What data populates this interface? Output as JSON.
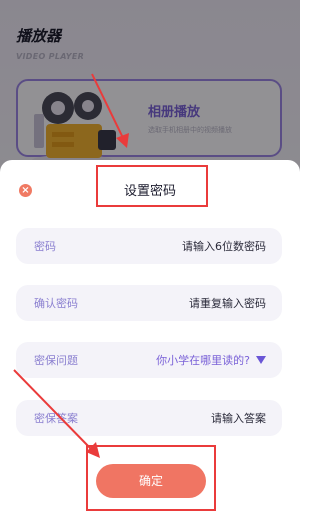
{
  "app": {
    "title": "播放器",
    "subtitle": "VIDEO PLAYER"
  },
  "album_card": {
    "title": "相册播放",
    "description": "选取手机相册中的视频播放"
  },
  "dialog": {
    "title": "设置密码",
    "close_icon": "close-icon",
    "fields": [
      {
        "label": "密码",
        "placeholder": "请输入6位数密码"
      },
      {
        "label": "确认密码",
        "placeholder": "请重复输入密码"
      },
      {
        "label": "密保问题",
        "value": "你小学在哪里读的?"
      },
      {
        "label": "密保答案",
        "placeholder": "请输入答案"
      }
    ],
    "confirm_label": "确定"
  },
  "colors": {
    "accent_purple": "#7b63d8",
    "confirm_coral": "#f07563",
    "annotation_red": "#ea3b3b"
  }
}
